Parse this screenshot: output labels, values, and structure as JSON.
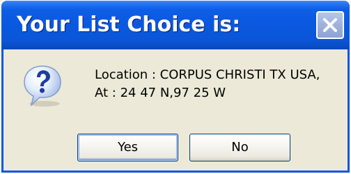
{
  "dialog": {
    "title": "Your List Choice is:",
    "icon": "question-icon",
    "message_line1": "Location : CORPUS CHRISTI TX USA,",
    "message_line2": "At : 24 47 N,97 25 W",
    "buttons": {
      "yes_label": "Yes",
      "no_label": "No"
    },
    "close_icon": "close-icon"
  },
  "colors": {
    "titlebar": "#0a58df",
    "window_border": "#0a55e0",
    "body_background": "#ece9d8",
    "close_button": "#9fb1dc"
  }
}
